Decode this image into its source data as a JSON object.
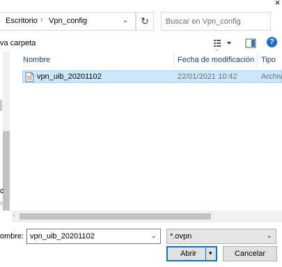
{
  "window": {
    "close_glyph": "×"
  },
  "address_bar": {
    "segments": [
      "Escritorio",
      "Vpn_config"
    ],
    "separator": "›",
    "dropdown_glyph": "⌄"
  },
  "refresh_glyph": "↻",
  "search": {
    "placeholder": "Buscar en Vpn_config"
  },
  "toolbar": {
    "new_folder_label": "va carpeta",
    "help_glyph": "?"
  },
  "nav_pane": {
    "visible_char": "c",
    "glyph": "›"
  },
  "file_list": {
    "columns": [
      "Nombre",
      "Fecha de modificación",
      "Tipo"
    ],
    "rows": [
      {
        "name": "vpn_uib_20201102",
        "modified": "22/01/2021 10:42",
        "type": "Archiv",
        "selected": true
      }
    ]
  },
  "bottom": {
    "filename_label": "ombre:",
    "filename_value": "vpn_uib_20201102",
    "filter_value": "*.ovpn",
    "open_label": "Abrir",
    "open_dropdown_glyph": "▾",
    "cancel_label": "Cancelar",
    "dropdown_glyph": "⌄"
  },
  "colors": {
    "selection_bg": "#cce8ff",
    "selection_border": "#99d1ff",
    "header_text": "#1f3d7a",
    "default_button_border": "#0078d7",
    "help_icon_bg": "#1c6dd0"
  },
  "icons": {
    "close": "close-icon",
    "refresh": "refresh-icon",
    "view": "view-options-icon",
    "pane": "preview-pane-icon",
    "help": "help-icon",
    "file": "ovpn-file-icon"
  }
}
